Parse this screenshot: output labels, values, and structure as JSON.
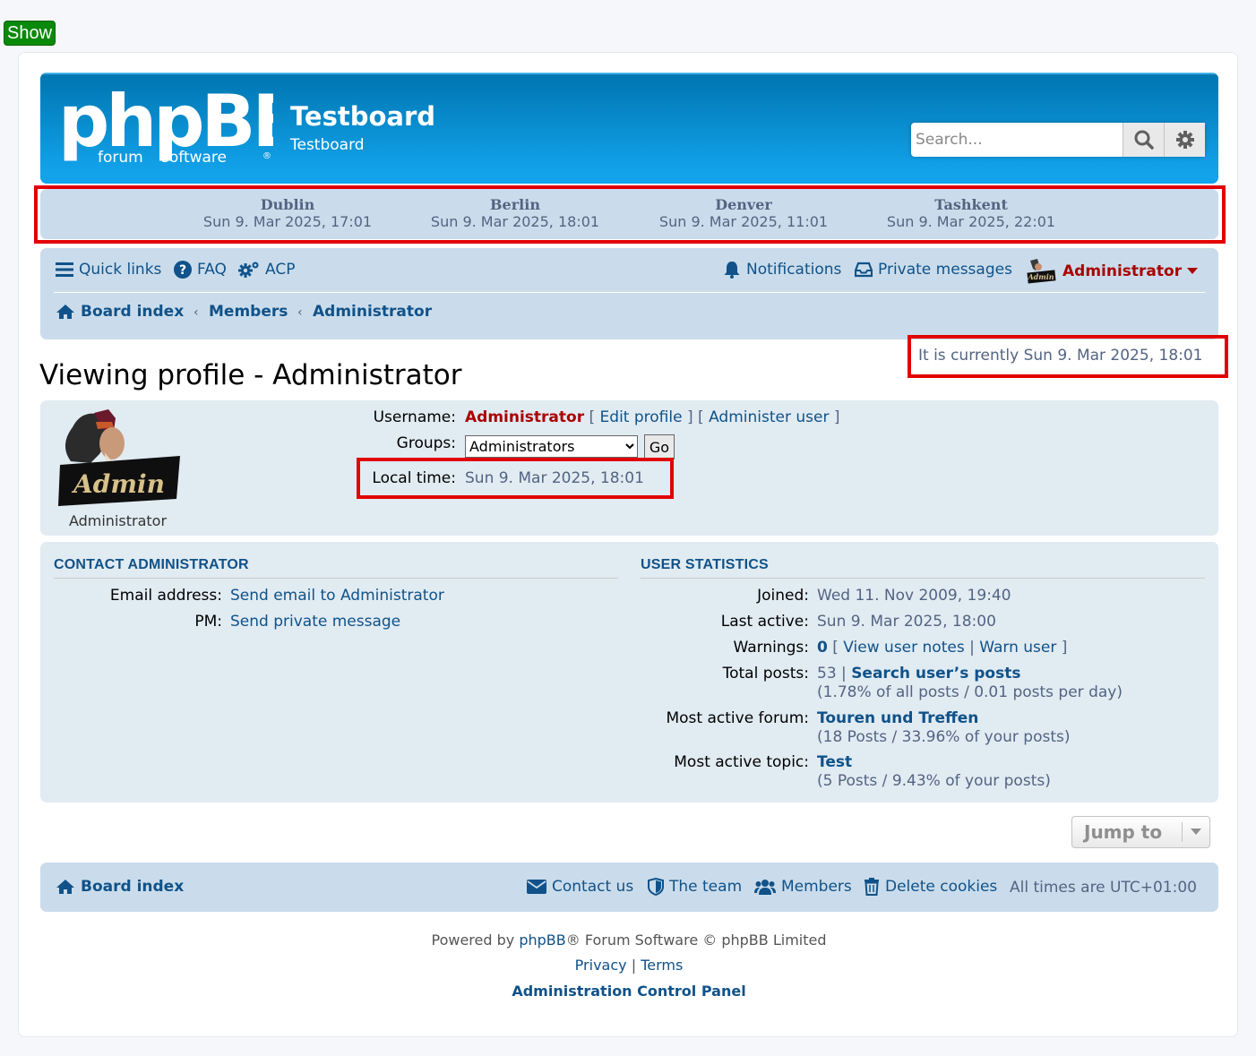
{
  "show_button": "Show",
  "header": {
    "site_title": "Testboard",
    "site_description": "Testboard",
    "search_placeholder": "Search...",
    "brand_color": "#0076b1"
  },
  "world_clock": [
    {
      "city": "Dublin",
      "time": "Sun 9. Mar 2025, 17:01"
    },
    {
      "city": "Berlin",
      "time": "Sun 9. Mar 2025, 18:01"
    },
    {
      "city": "Denver",
      "time": "Sun 9. Mar 2025, 11:01"
    },
    {
      "city": "Tashkent",
      "time": "Sun 9. Mar 2025, 22:01"
    }
  ],
  "nav": {
    "quick_links": "Quick links",
    "faq": "FAQ",
    "acp": "ACP",
    "notifications": "Notifications",
    "private_messages": "Private messages",
    "user": "Administrator"
  },
  "breadcrumbs": [
    "Board index",
    "Members",
    "Administrator"
  ],
  "current_time": "It is currently Sun 9. Mar 2025, 18:01",
  "page_title": "Viewing profile - Administrator",
  "profile": {
    "avatar_text": "Admin",
    "avatar_caption": "Administrator",
    "username_label": "Username:",
    "username": "Administrator",
    "edit_profile": "Edit profile",
    "administer_user": "Administer user",
    "groups_label": "Groups:",
    "groups_selected": "Administrators",
    "go_label": "Go",
    "local_time_label": "Local time:",
    "local_time": "Sun 9. Mar 2025, 18:01"
  },
  "contact": {
    "title": "CONTACT ADMINISTRATOR",
    "email_label": "Email address:",
    "email_link": "Send email to Administrator",
    "pm_label": "PM:",
    "pm_link": "Send private message"
  },
  "stats": {
    "title": "USER STATISTICS",
    "joined_label": "Joined:",
    "joined": "Wed 11. Nov 2009, 19:40",
    "last_active_label": "Last active:",
    "last_active": "Sun 9. Mar 2025, 18:00",
    "warnings_label": "Warnings:",
    "warnings_count": "0",
    "view_user_notes": "View user notes",
    "warn_user": "Warn user",
    "total_posts_label": "Total posts:",
    "total_posts": "53",
    "search_posts": "Search user’s posts",
    "posts_detail": "(1.78% of all posts / 0.01 posts per day)",
    "active_forum_label": "Most active forum:",
    "active_forum": "Touren und Treffen",
    "active_forum_detail": "(18 Posts / 33.96% of your posts)",
    "active_topic_label": "Most active topic:",
    "active_topic": "Test",
    "active_topic_detail": "(5 Posts / 9.43% of your posts)"
  },
  "jump_to": "Jump to",
  "footer_nav": {
    "board_index": "Board index",
    "contact_us": "Contact us",
    "the_team": "The team",
    "members": "Members",
    "delete_cookies": "Delete cookies",
    "timezone": "All times are UTC+01:00"
  },
  "copyright": {
    "powered_prefix": "Powered by ",
    "phpbb_link": "phpBB",
    "powered_suffix": "® Forum Software © phpBB Limited",
    "privacy": "Privacy",
    "separator": "|",
    "terms": "Terms",
    "acp_link": "Administration Control Panel"
  }
}
